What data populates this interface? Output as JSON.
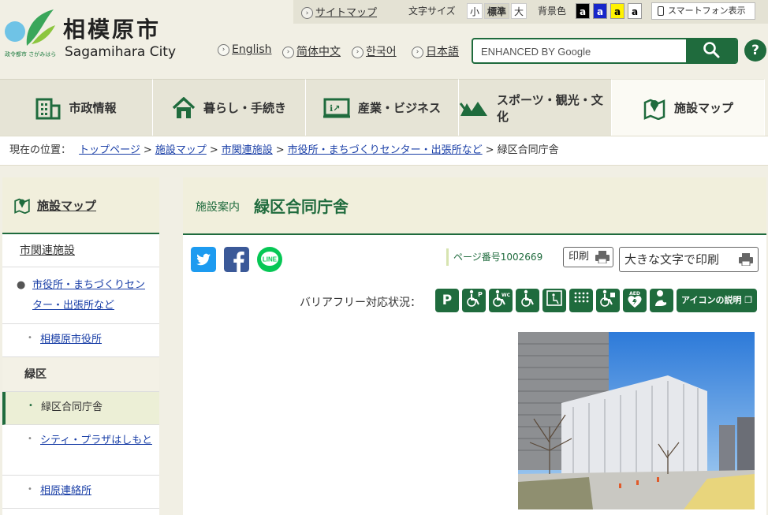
{
  "header": {
    "logo_jp": "相模原市",
    "logo_en": "Sagamihara City",
    "logo_sub": "政令都市 さがみはら",
    "sitemap": "サイトマップ",
    "font_size_label": "文字サイズ",
    "font_sizes": [
      "小",
      "標準",
      "大"
    ],
    "bg_label": "背景色",
    "bg_buttons": [
      "a",
      "a",
      "a",
      "a"
    ],
    "smartphone": "スマートフォン表示",
    "languages": [
      "English",
      "简体中文",
      "한국어",
      "日本語"
    ],
    "search_placeholder": "ENHANCED BY Google",
    "help": "?"
  },
  "nav": [
    "市政情報",
    "暮らし・手続き",
    "産業・ビジネス",
    "スポーツ・観光・文化",
    "施設マップ"
  ],
  "breadcrumb": {
    "label": "現在の位置：",
    "links": [
      "トップページ",
      "施設マップ",
      "市関連施設",
      "市役所・まちづくりセンター・出張所など"
    ],
    "current": "緑区合同庁舎"
  },
  "sidebar": {
    "head": "施設マップ",
    "section": "市関連施設",
    "item1": "市役所・まちづくりセンター・出張所など",
    "item2": "相模原市役所",
    "group": "緑区",
    "item3": "緑区合同庁舎",
    "item4": "シティ・プラザはしもと",
    "item5": "相原連絡所"
  },
  "main": {
    "category": "施設案内",
    "title": "緑区合同庁舎",
    "page_number": "ページ番号1002669",
    "print": "印刷",
    "print_large": "大きな文字で印刷",
    "barrier_free_label": "バリアフリー対応状況：",
    "icon_explain": "アイコンの説明"
  },
  "colors": {
    "brand_green": "#1f6b3d",
    "link_blue": "#1a3fa7",
    "bg_beige": "#f1efe4"
  }
}
